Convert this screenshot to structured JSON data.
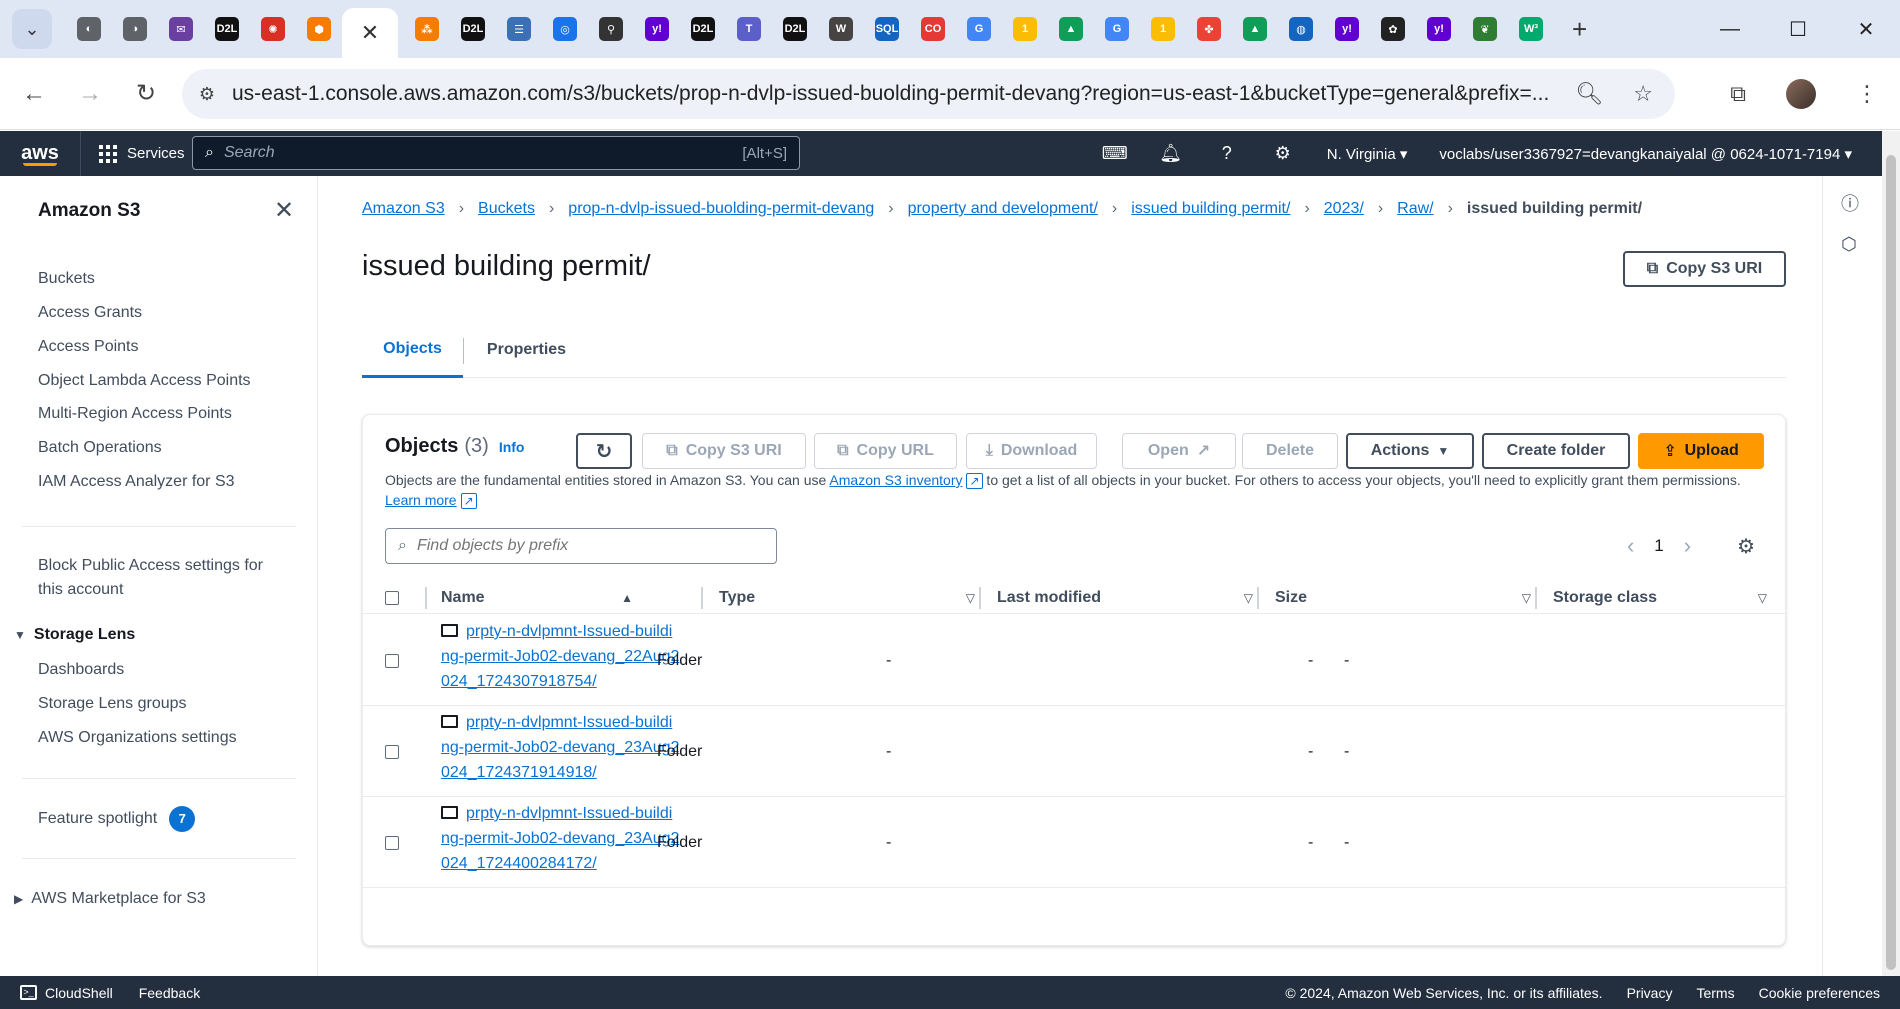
{
  "browser": {
    "tabs": [
      {
        "icon": "chrome-icon",
        "color": "#5f6368",
        "glyph": "◐"
      },
      {
        "icon": "globe-icon",
        "color": "#5f6368",
        "glyph": "◑"
      },
      {
        "icon": "mail-icon",
        "color": "#6b3fa0",
        "glyph": "✉"
      },
      {
        "icon": "d2l-icon",
        "color": "#111111",
        "glyph": "D2L"
      },
      {
        "icon": "wheel-icon",
        "color": "#d93025",
        "glyph": "✺"
      },
      {
        "icon": "cube-icon",
        "color": "#f57c00",
        "glyph": "⬢"
      },
      {
        "icon": "active-tab-close-icon",
        "active": true,
        "glyph": "✕"
      },
      {
        "icon": "triad-icon",
        "color": "#f57c00",
        "glyph": "⁂"
      },
      {
        "icon": "d2l-icon",
        "color": "#111111",
        "glyph": "D2L"
      },
      {
        "icon": "form-icon",
        "color": "#3b6fb6",
        "glyph": "☰"
      },
      {
        "icon": "spiral-icon",
        "color": "#1a73e8",
        "glyph": "◎"
      },
      {
        "icon": "bike-icon",
        "color": "#333333",
        "glyph": "⚲"
      },
      {
        "icon": "yahoo-icon",
        "color": "#6001d2",
        "glyph": "y!"
      },
      {
        "icon": "d2l-icon",
        "color": "#111111",
        "glyph": "D2L"
      },
      {
        "icon": "teams-icon",
        "color": "#5b5fc7",
        "glyph": "T"
      },
      {
        "icon": "d2l-icon",
        "color": "#111111",
        "glyph": "D2L"
      },
      {
        "icon": "wordpress-icon",
        "color": "#464342",
        "glyph": "W"
      },
      {
        "icon": "sql-icon",
        "color": "#1565c0",
        "glyph": "SQL"
      },
      {
        "icon": "coursera-icon",
        "color": "#e53935",
        "glyph": "CO"
      },
      {
        "icon": "google-icon",
        "color": "#4285f4",
        "glyph": "G"
      },
      {
        "icon": "one-icon",
        "color": "#fbbc04",
        "glyph": "1"
      },
      {
        "icon": "drive-icon",
        "color": "#0f9d58",
        "glyph": "▲"
      },
      {
        "icon": "google-icon",
        "color": "#4285f4",
        "glyph": "G"
      },
      {
        "icon": "one-icon",
        "color": "#fbbc04",
        "glyph": "1"
      },
      {
        "icon": "photos-icon",
        "color": "#ea4335",
        "glyph": "✤"
      },
      {
        "icon": "drive-icon",
        "color": "#0f9d58",
        "glyph": "▲"
      },
      {
        "icon": "globe-blue-icon",
        "color": "#1565c0",
        "glyph": "◍"
      },
      {
        "icon": "yahoo-icon",
        "color": "#6001d2",
        "glyph": "y!"
      },
      {
        "icon": "openai-icon",
        "color": "#222222",
        "glyph": "✿"
      },
      {
        "icon": "yahoo-icon",
        "color": "#6001d2",
        "glyph": "y!"
      },
      {
        "icon": "leaf-icon",
        "color": "#2e7d32",
        "glyph": "❦"
      },
      {
        "icon": "w3-icon",
        "color": "#04aa6d",
        "glyph": "W³"
      }
    ],
    "new_tab": "+",
    "url": "us-east-1.console.aws.amazon.com/s3/buckets/prop-n-dvlp-issued-buolding-permit-devang?region=us-east-1&bucketType=general&prefix=..."
  },
  "aws": {
    "logo": "aws",
    "services_label": "Services",
    "search_placeholder": "Search",
    "search_shortcut": "[Alt+S]",
    "region": "N. Virginia ▾",
    "account": "voclabs/user3367927=devangkanaiyalal @ 0624-1071-7194 ▾"
  },
  "sidebar": {
    "title": "Amazon S3",
    "items": [
      "Buckets",
      "Access Grants",
      "Access Points",
      "Object Lambda Access Points",
      "Multi-Region Access Points",
      "Batch Operations",
      "IAM Access Analyzer for S3"
    ],
    "block_public_1": "Block Public Access settings for",
    "block_public_2": "this account",
    "storage_lens": "Storage Lens",
    "lens_items": [
      "Dashboards",
      "Storage Lens groups",
      "AWS Organizations settings"
    ],
    "feature_spotlight": "Feature spotlight",
    "feature_count": "7",
    "marketplace": "AWS Marketplace for S3"
  },
  "breadcrumb": {
    "items": [
      "Amazon S3",
      "Buckets",
      "prop-n-dvlp-issued-buolding-permit-devang",
      "property and development/",
      "issued building permit/",
      "2023/",
      "Raw/"
    ],
    "current": "issued building permit/"
  },
  "page": {
    "title": "issued building permit/",
    "copy_uri": "Copy S3 URI",
    "tabs": [
      "Objects",
      "Properties"
    ]
  },
  "objects": {
    "heading": "Objects",
    "count": "(3)",
    "info": "Info",
    "buttons": {
      "copy_uri": "Copy S3 URI",
      "copy_url": "Copy URL",
      "download": "Download",
      "open": "Open",
      "delete": "Delete",
      "actions": "Actions",
      "create_folder": "Create folder",
      "upload": "Upload"
    },
    "desc_1": "Objects are the fundamental entities stored in Amazon S3. You can use ",
    "desc_link": "Amazon S3 inventory",
    "desc_2": " to get a list of all objects in your bucket. For others to access your objects, you'll need to explicitly grant them permissions. ",
    "desc_learn": "Learn more",
    "search_placeholder": "Find objects by prefix",
    "page": "1",
    "columns": [
      "Name",
      "Type",
      "Last modified",
      "Size",
      "Storage class"
    ],
    "rows": [
      {
        "name": "prpty-n-dvlpmnt-Issued-building-permit-Job02-devang_22Aug2024_1724307918754/",
        "type": "Folder",
        "modified": "-",
        "size": "-",
        "class": "-"
      },
      {
        "name": "prpty-n-dvlpmnt-Issued-building-permit-Job02-devang_23Aug2024_1724371914918/",
        "type": "Folder",
        "modified": "-",
        "size": "-",
        "class": "-"
      },
      {
        "name": "prpty-n-dvlpmnt-Issued-building-permit-Job02-devang_23Aug2024_1724400284172/",
        "type": "Folder",
        "modified": "-",
        "size": "-",
        "class": "-"
      }
    ]
  },
  "footer": {
    "cloudshell": "CloudShell",
    "feedback": "Feedback",
    "copyright": "© 2024, Amazon Web Services, Inc. or its affiliates.",
    "privacy": "Privacy",
    "terms": "Terms",
    "cookies": "Cookie preferences"
  }
}
